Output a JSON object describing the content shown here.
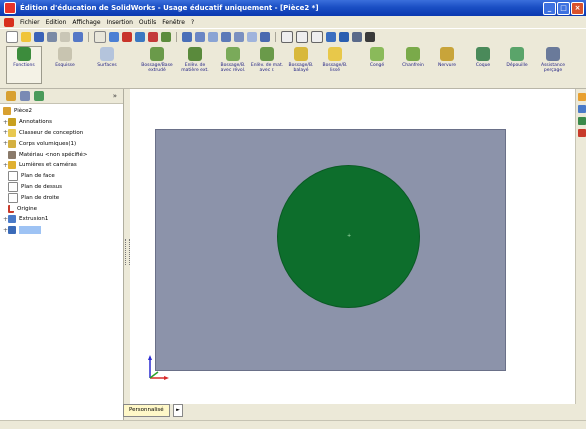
{
  "window": {
    "title": "Édition d'éducation de SolidWorks - Usage éducatif uniquement - [Pièce2 *]",
    "buttons": [
      "_",
      "□",
      "×"
    ]
  },
  "menu": {
    "items": [
      "Fichier",
      "Edition",
      "Affichage",
      "Insertion",
      "Outils",
      "Fenêtre",
      "?"
    ]
  },
  "command_manager": {
    "tabs": [
      "Fonctions",
      "Esquisse",
      "Surfaces"
    ],
    "commands": [
      "Bossage/Base extrudé",
      "Enlèv. de matière ext.",
      "Bossage/B. avec révol.",
      "Enlèv. de mat. avec r.",
      "Bossage/B. balayé",
      "Bossage/B. lissé",
      "Congé",
      "Chanfrein",
      "Nervure",
      "Coque",
      "Dépouille",
      "Assistance perçage"
    ]
  },
  "feature_tree": {
    "items": [
      "Pièce2",
      "Annotations",
      "Classeur de conception",
      "Corps volumiques(1)",
      "Matériau <non spécifié>",
      "Lumières et caméras",
      "Plan de face",
      "Plan de dessus",
      "Plan de droite",
      "Origine",
      "Extrusion1"
    ]
  },
  "bottom": {
    "config_tab": "Personnalisé"
  },
  "colors": {
    "title_blue": "#1b4fc4",
    "plane": "#8c93aa",
    "extrusion_green": "#0d6e2c",
    "selection": "#9ec3f4"
  }
}
